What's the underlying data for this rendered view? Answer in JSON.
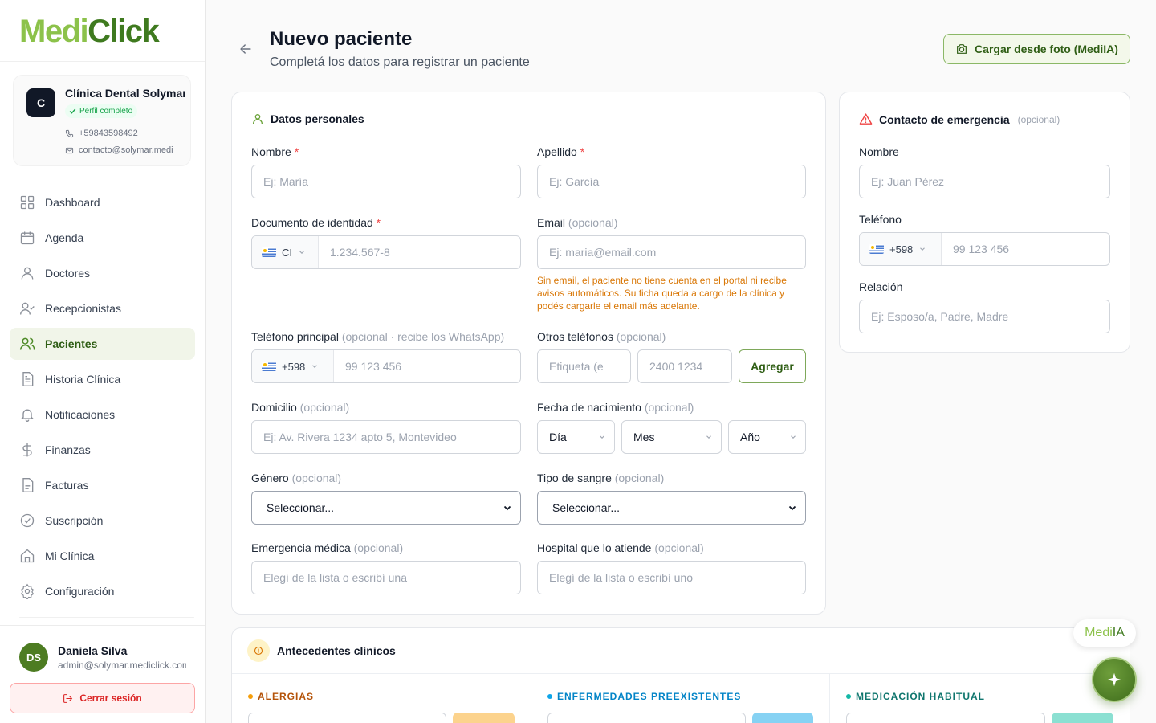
{
  "app": {
    "brand_part1": "Medi",
    "brand_part2": "Click"
  },
  "clinic": {
    "initial": "C",
    "name": "Clínica Dental Solymar",
    "badge": "Perfil completo",
    "phone": "+59843598492",
    "email": "contacto@solymar.medi"
  },
  "nav": [
    {
      "label": "Dashboard",
      "icon": "dashboard-icon",
      "active": false
    },
    {
      "label": "Agenda",
      "icon": "calendar-icon",
      "active": false
    },
    {
      "label": "Doctores",
      "icon": "user-icon",
      "active": false
    },
    {
      "label": "Recepcionistas",
      "icon": "user-check-icon",
      "active": false
    },
    {
      "label": "Pacientes",
      "icon": "users-icon",
      "active": true
    },
    {
      "label": "Historia Clínica",
      "icon": "file-text-icon",
      "active": false
    },
    {
      "label": "Notificaciones",
      "icon": "bell-icon",
      "active": false
    },
    {
      "label": "Finanzas",
      "icon": "dollar-icon",
      "active": false
    },
    {
      "label": "Facturas",
      "icon": "invoice-icon",
      "active": false
    },
    {
      "label": "Suscripción",
      "icon": "badge-check-icon",
      "active": false
    },
    {
      "label": "Mi Clínica",
      "icon": "home-icon",
      "active": false
    },
    {
      "label": "Configuración",
      "icon": "gear-icon",
      "active": false
    }
  ],
  "user": {
    "initials": "DS",
    "name": "Daniela Silva",
    "email": "admin@solymar.mediclick.com",
    "logout_label": "Cerrar sesión"
  },
  "header": {
    "title": "Nuevo paciente",
    "subtitle": "Completá los datos para registrar un paciente",
    "photo_button": "Cargar desde foto (MediIA)"
  },
  "personal": {
    "heading": "Datos personales",
    "required_mark": "*",
    "optional_text": "(opcional)",
    "nombre": {
      "label": "Nombre",
      "placeholder": "Ej: María"
    },
    "apellido": {
      "label": "Apellido",
      "placeholder": "Ej: García"
    },
    "documento": {
      "label": "Documento de identidad",
      "doc_type": "CI",
      "placeholder": "1.234.567-8"
    },
    "email": {
      "label": "Email",
      "placeholder": "Ej: maria@email.com",
      "warning": "Sin email, el paciente no tiene cuenta en el portal ni recibe avisos automáticos. Su ficha queda a cargo de la clínica y podés cargarle el email más adelante."
    },
    "telefono": {
      "label": "Teléfono principal",
      "hint": "(opcional · recibe los WhatsApp)",
      "prefix": "+598",
      "placeholder": "99 123 456"
    },
    "otros_telefonos": {
      "label": "Otros teléfonos",
      "label_placeholder": "Etiqueta (e",
      "number_placeholder": "2400 1234",
      "add_button": "Agregar"
    },
    "domicilio": {
      "label": "Domicilio",
      "placeholder": "Ej: Av. Rivera 1234 apto 5, Montevideo"
    },
    "nacimiento": {
      "label": "Fecha de nacimiento",
      "day": "Día",
      "month": "Mes",
      "year": "Año"
    },
    "genero": {
      "label": "Género",
      "value": "Seleccionar..."
    },
    "sangre": {
      "label": "Tipo de sangre",
      "value": "Seleccionar..."
    },
    "emergencia_medica": {
      "label": "Emergencia médica",
      "placeholder": "Elegí de la lista o escribí una"
    },
    "hospital": {
      "label": "Hospital que lo atiende",
      "placeholder": "Elegí de la lista o escribí uno"
    }
  },
  "emergency_contact": {
    "heading": "Contacto de emergencia",
    "optional": "(opcional)",
    "nombre": {
      "label": "Nombre",
      "placeholder": "Ej: Juan Pérez"
    },
    "telefono": {
      "label": "Teléfono",
      "prefix": "+598",
      "placeholder": "99 123 456"
    },
    "relacion": {
      "label": "Relación",
      "placeholder": "Ej: Esposo/a, Padre, Madre"
    }
  },
  "antecedentes": {
    "heading": "Antecedentes clínicos",
    "sections": [
      {
        "label": "ALERGIAS",
        "color": "#f59e0b",
        "button_color": "#fcd38d"
      },
      {
        "label": "ENFERMEDADES PREEXISTENTES",
        "color": "#0ea5e9",
        "button_color": "#86d2f3"
      },
      {
        "label": "MEDICACIÓN HABITUAL",
        "color": "#14b8a6",
        "button_color": "#8be0d2"
      }
    ]
  },
  "assistant": {
    "name_part1": "Medi",
    "name_part2": "IA"
  },
  "colors": {
    "brand_light": "#8cc24a",
    "brand_dark": "#3f7a1f",
    "danger": "#dc2626",
    "warning": "#d97706"
  }
}
